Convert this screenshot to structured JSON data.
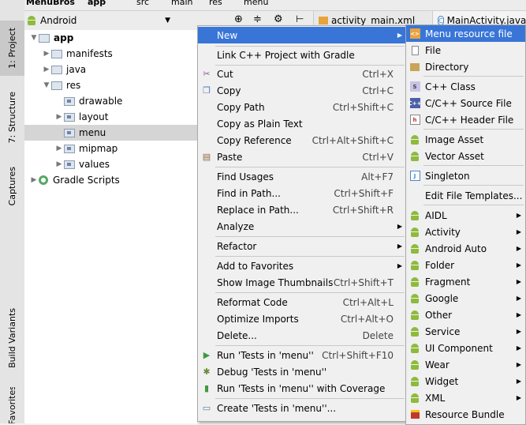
{
  "breadcrumbs": [
    "MenuBros",
    "app",
    "src",
    "main",
    "res",
    "menu"
  ],
  "project_view": {
    "label": "Android"
  },
  "side_tabs": [
    "1: Project",
    "7: Structure",
    "Captures",
    "Build Variants",
    "Favorites"
  ],
  "editor_tabs": [
    "activity_main.xml",
    "MainActivity.java"
  ],
  "tree": [
    {
      "label": "app",
      "bold": true
    },
    {
      "label": "manifests"
    },
    {
      "label": "java"
    },
    {
      "label": "res"
    },
    {
      "label": "drawable"
    },
    {
      "label": "layout"
    },
    {
      "label": "menu"
    },
    {
      "label": "mipmap"
    },
    {
      "label": "values"
    },
    {
      "label": "Gradle Scripts"
    }
  ],
  "context_menu": [
    {
      "label": "New",
      "shortcut": ""
    },
    {
      "label": "Link C++ Project with Gradle",
      "shortcut": ""
    },
    {
      "label": "Cut",
      "shortcut": "Ctrl+X"
    },
    {
      "label": "Copy",
      "shortcut": "Ctrl+C"
    },
    {
      "label": "Copy Path",
      "shortcut": "Ctrl+Shift+C"
    },
    {
      "label": "Copy as Plain Text",
      "shortcut": ""
    },
    {
      "label": "Copy Reference",
      "shortcut": "Ctrl+Alt+Shift+C"
    },
    {
      "label": "Paste",
      "shortcut": "Ctrl+V"
    },
    {
      "label": "Find Usages",
      "shortcut": "Alt+F7"
    },
    {
      "label": "Find in Path...",
      "shortcut": "Ctrl+Shift+F"
    },
    {
      "label": "Replace in Path...",
      "shortcut": "Ctrl+Shift+R"
    },
    {
      "label": "Analyze",
      "shortcut": ""
    },
    {
      "label": "Refactor",
      "shortcut": ""
    },
    {
      "label": "Add to Favorites",
      "shortcut": ""
    },
    {
      "label": "Show Image Thumbnails",
      "shortcut": "Ctrl+Shift+T"
    },
    {
      "label": "Reformat Code",
      "shortcut": "Ctrl+Alt+L"
    },
    {
      "label": "Optimize Imports",
      "shortcut": "Ctrl+Alt+O"
    },
    {
      "label": "Delete...",
      "shortcut": "Delete"
    },
    {
      "label": "Run 'Tests in 'menu''",
      "shortcut": "Ctrl+Shift+F10"
    },
    {
      "label": "Debug 'Tests in 'menu''",
      "shortcut": ""
    },
    {
      "label": "Run 'Tests in 'menu'' with Coverage",
      "shortcut": ""
    },
    {
      "label": "Create 'Tests in 'menu''...",
      "shortcut": ""
    }
  ],
  "submenu": [
    {
      "label": "Menu resource file"
    },
    {
      "label": "File"
    },
    {
      "label": "Directory"
    },
    {
      "label": "C++ Class"
    },
    {
      "label": "C/C++ Source File"
    },
    {
      "label": "C/C++ Header File"
    },
    {
      "label": "Image Asset"
    },
    {
      "label": "Vector Asset"
    },
    {
      "label": "Singleton"
    },
    {
      "label": "Edit File Templates..."
    },
    {
      "label": "AIDL"
    },
    {
      "label": "Activity"
    },
    {
      "label": "Android Auto"
    },
    {
      "label": "Folder"
    },
    {
      "label": "Fragment"
    },
    {
      "label": "Google"
    },
    {
      "label": "Other"
    },
    {
      "label": "Service"
    },
    {
      "label": "UI Component"
    },
    {
      "label": "Wear"
    },
    {
      "label": "Widget"
    },
    {
      "label": "XML"
    },
    {
      "label": "Resource Bundle"
    }
  ],
  "colors": {
    "highlight": "#3875d7",
    "android_green": "#8dbb3c"
  }
}
